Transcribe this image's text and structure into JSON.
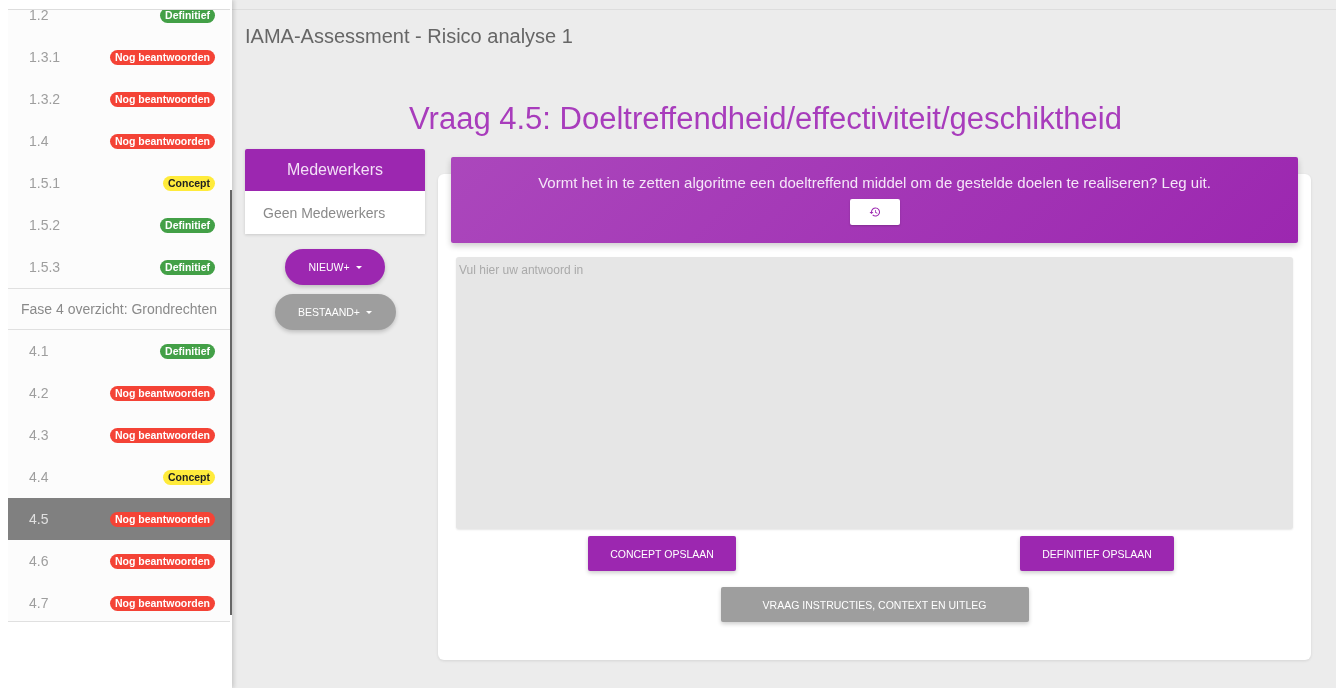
{
  "sidebar": {
    "items": [
      {
        "kind": "question",
        "label": "1.2",
        "status": "Definitief",
        "color": "#43a047",
        "selected": false
      },
      {
        "kind": "question",
        "label": "1.3.1",
        "status": "Nog beantwoorden",
        "color": "#f44336",
        "selected": false
      },
      {
        "kind": "question",
        "label": "1.3.2",
        "status": "Nog beantwoorden",
        "color": "#f44336",
        "selected": false
      },
      {
        "kind": "question",
        "label": "1.4",
        "status": "Nog beantwoorden",
        "color": "#f44336",
        "selected": false
      },
      {
        "kind": "question",
        "label": "1.5.1",
        "status": "Concept",
        "color": "#ffeb3b",
        "selected": false
      },
      {
        "kind": "question",
        "label": "1.5.2",
        "status": "Definitief",
        "color": "#43a047",
        "selected": false
      },
      {
        "kind": "question",
        "label": "1.5.3",
        "status": "Definitief",
        "color": "#43a047",
        "selected": false
      },
      {
        "kind": "section",
        "label": "Fase 4 overzicht: Grondrechten"
      },
      {
        "kind": "question",
        "label": "4.1",
        "status": "Definitief",
        "color": "#43a047",
        "selected": false
      },
      {
        "kind": "question",
        "label": "4.2",
        "status": "Nog beantwoorden",
        "color": "#f44336",
        "selected": false
      },
      {
        "kind": "question",
        "label": "4.3",
        "status": "Nog beantwoorden",
        "color": "#f44336",
        "selected": false
      },
      {
        "kind": "question",
        "label": "4.4",
        "status": "Concept",
        "color": "#ffeb3b",
        "selected": false
      },
      {
        "kind": "question",
        "label": "4.5",
        "status": "Nog beantwoorden",
        "color": "#f44336",
        "selected": true
      },
      {
        "kind": "question",
        "label": "4.6",
        "status": "Nog beantwoorden",
        "color": "#f44336",
        "selected": false
      },
      {
        "kind": "question",
        "label": "4.7",
        "status": "Nog beantwoorden",
        "color": "#f44336",
        "selected": false
      }
    ]
  },
  "app_title": "IAMA-Assessment - Risico analyse 1",
  "question_title": "Vraag 4.5: Doeltreffendheid/effectiviteit/geschiktheid",
  "collaborators": {
    "title": "Medewerkers",
    "empty_text": "Geen Medewerkers",
    "buttons": [
      {
        "label": "NIEUW+",
        "kind": "primary"
      },
      {
        "label": "BESTAAND+",
        "kind": "secondary"
      }
    ]
  },
  "question": {
    "text": "Vormt het in te zetten algoritme een doeltreffend middel om de gestelde doelen te realiseren? Leg uit.",
    "answer": {
      "placeholder": "Vul hier uw antwoord in"
    },
    "save_buttons": [
      {
        "label": "CONCEPT OPSLAAN",
        "kind": "primary"
      },
      {
        "label": "DEFINITIEF OPSLAAN",
        "kind": "primary"
      }
    ],
    "help_button": {
      "label": "VRAAG INSTRUCTIES, CONTEXT EN UITLEG",
      "kind": "secondary"
    }
  }
}
